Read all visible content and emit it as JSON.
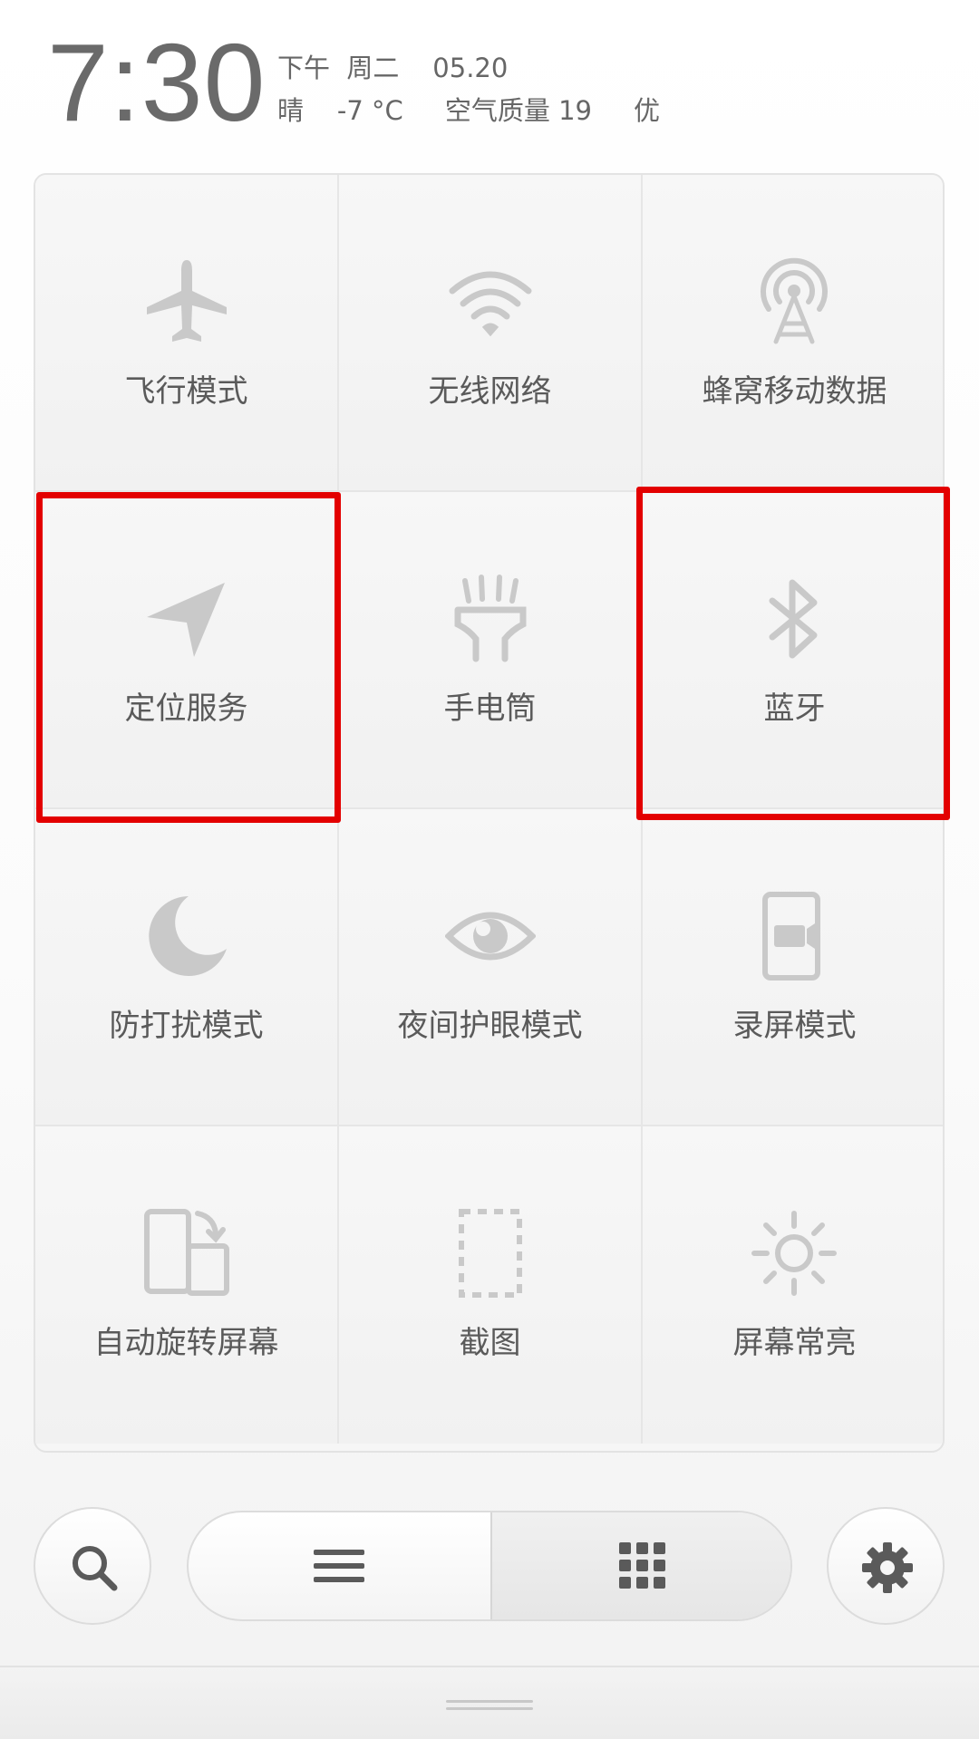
{
  "status": {
    "time": "7:30",
    "line1": "下午  周二    05.20",
    "line2": "晴    -7 °C     空气质量 19     优"
  },
  "toggles": [
    {
      "id": "airplane",
      "label": "飞行模式",
      "icon": "airplane-icon"
    },
    {
      "id": "wifi",
      "label": "无线网络",
      "icon": "wifi-icon"
    },
    {
      "id": "cellular",
      "label": "蜂窝移动数据",
      "icon": "cellular-tower-icon"
    },
    {
      "id": "location",
      "label": "定位服务",
      "icon": "location-arrow-icon",
      "highlighted": true
    },
    {
      "id": "flashlight",
      "label": "手电筒",
      "icon": "flashlight-icon"
    },
    {
      "id": "bluetooth",
      "label": "蓝牙",
      "icon": "bluetooth-icon",
      "highlighted": true
    },
    {
      "id": "dnd",
      "label": "防打扰模式",
      "icon": "moon-icon"
    },
    {
      "id": "nightmode",
      "label": "夜间护眼模式",
      "icon": "eye-icon"
    },
    {
      "id": "screenrec",
      "label": "录屏模式",
      "icon": "screen-record-icon"
    },
    {
      "id": "autorotate",
      "label": "自动旋转屏幕",
      "icon": "rotate-phone-icon"
    },
    {
      "id": "screenshot",
      "label": "截图",
      "icon": "screenshot-icon"
    },
    {
      "id": "keepon",
      "label": "屏幕常亮",
      "icon": "sun-icon"
    }
  ],
  "bottom": {
    "search_icon": "search-icon",
    "list_icon": "list-icon",
    "grid_icon": "grid-icon",
    "grid_selected": true,
    "settings_icon": "gear-icon"
  },
  "colors": {
    "highlight": "#e30000",
    "icon": "#c9c9c9",
    "label": "#5a5a5a"
  }
}
